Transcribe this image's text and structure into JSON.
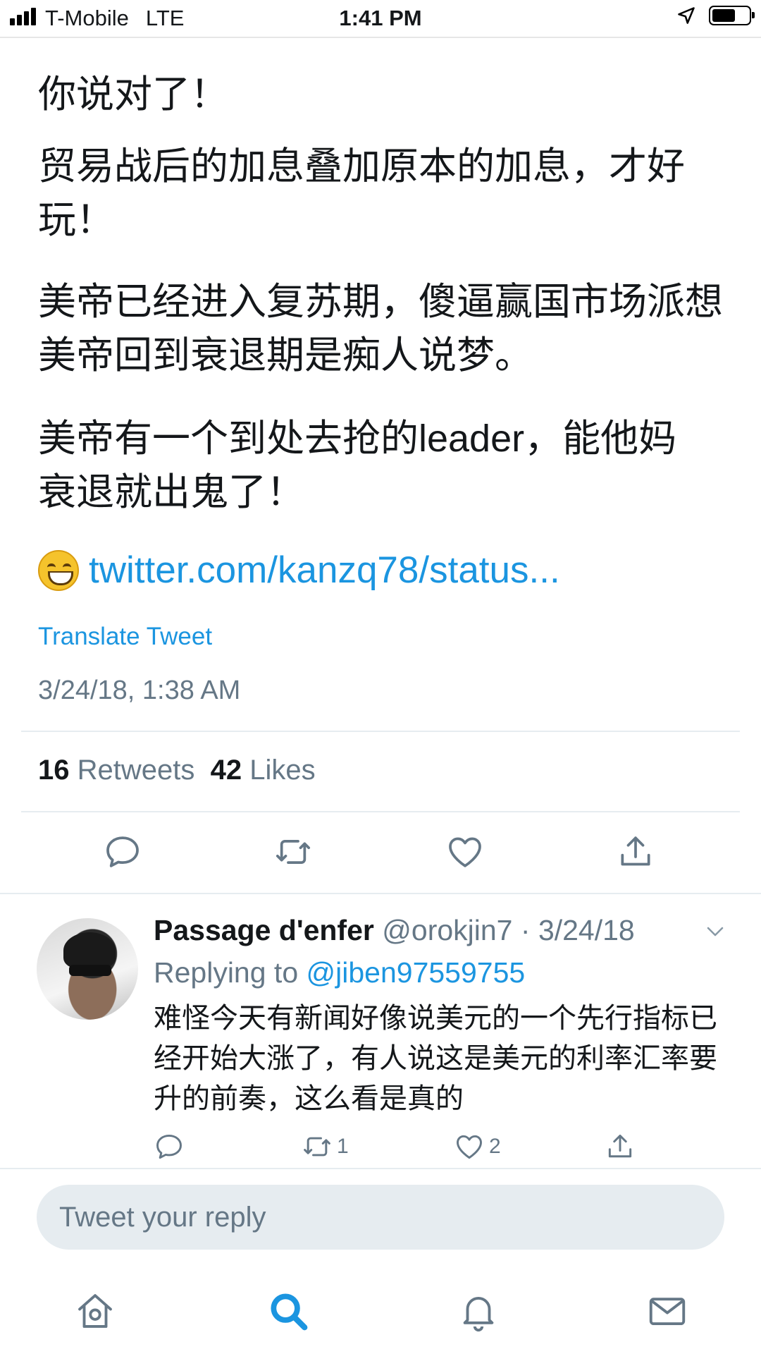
{
  "status_bar": {
    "carrier": "T-Mobile",
    "network": "LTE",
    "time": "1:41 PM"
  },
  "tweet": {
    "paragraphs": [
      "你说对了！",
      "贸易战后的加息叠加原本的加息，才好玩！",
      "美帝已经进入复苏期，傻逼赢国市场派想美帝回到衰退期是痴人说梦。",
      "美帝有一个到处去抢的leader，能他妈衰退就出鬼了！"
    ],
    "emoji": "grinning-face",
    "link": "twitter.com/kanzq78/status...",
    "translate_label": "Translate Tweet",
    "timestamp": "3/24/18, 1:38 AM",
    "retweets_count": "16",
    "retweets_label": "Retweets",
    "likes_count": "42",
    "likes_label": "Likes"
  },
  "reply": {
    "name": "Passage d'enfer",
    "handle": "@orokjin7",
    "separator": "·",
    "date": "3/24/18",
    "replying_prefix": "Replying to",
    "replying_to": "@jiben97559755",
    "text": "难怪今天有新闻好像说美元的一个先行指标已经开始大涨了，有人说这是美元的利率汇率要升的前奏，这么看是真的",
    "retweet_count": "1",
    "like_count": "2"
  },
  "compose": {
    "placeholder": "Tweet your reply"
  },
  "tab_bar": {
    "active_tab": "search",
    "tabs": [
      "home",
      "search",
      "notifications",
      "messages"
    ]
  },
  "colors": {
    "link_blue": "#1b95e0",
    "secondary_gray": "#657786",
    "text": "#14171a",
    "divider": "#e6ecf0"
  }
}
